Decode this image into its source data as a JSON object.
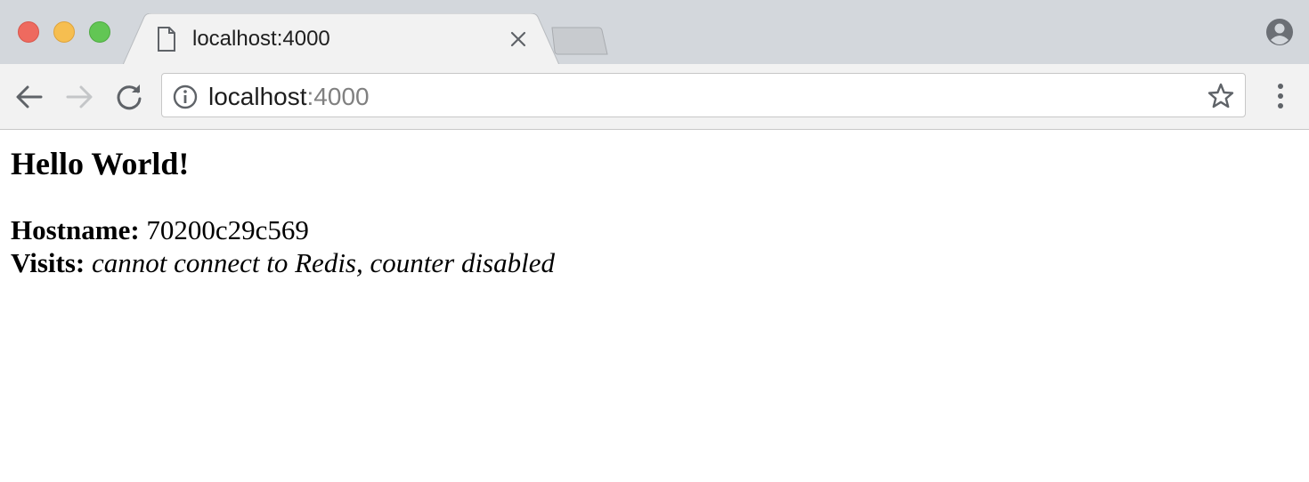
{
  "browser": {
    "tab": {
      "title": "localhost:4000",
      "icon": "document-icon"
    },
    "address_bar": {
      "host": "localhost",
      "port": ":4000",
      "security_icon": "info-icon"
    },
    "icons": {
      "back": "arrow-left-icon",
      "forward": "arrow-right-icon",
      "reload": "reload-icon",
      "bookmark": "star-icon",
      "menu": "kebab-menu-icon",
      "profile": "account-icon",
      "tab_close": "close-icon"
    },
    "colors": {
      "traffic_close": "#ee6a5f",
      "traffic_minimize": "#f6be50",
      "traffic_maximize": "#62c654",
      "titlebar": "#d3d7dc",
      "toolbar": "#f2f2f2"
    }
  },
  "page": {
    "heading": "Hello World!",
    "hostname_label": "Hostname:",
    "hostname_value": "70200c29c569",
    "visits_label": "Visits:",
    "visits_value": "cannot connect to Redis, counter disabled"
  }
}
